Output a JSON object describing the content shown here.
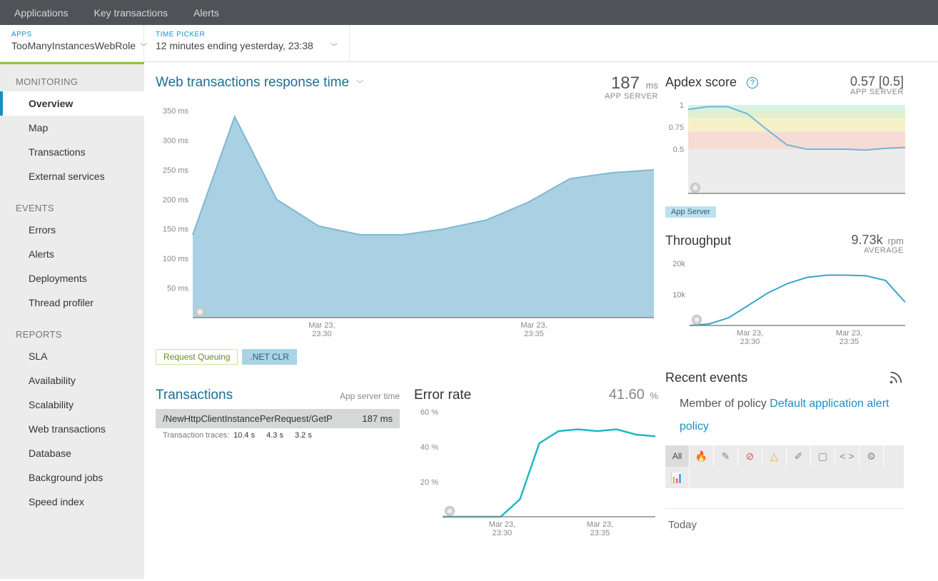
{
  "topnav": {
    "items": [
      "Applications",
      "Key transactions",
      "Alerts"
    ]
  },
  "subbar": {
    "apps_label": "APPS",
    "apps_value": "TooManyInstancesWebRole",
    "time_label": "TIME PICKER",
    "time_value": "12 minutes ending yesterday, 23:38"
  },
  "sidebar": {
    "groups": [
      {
        "label": "MONITORING",
        "items": [
          "Overview",
          "Map",
          "Transactions",
          "External services"
        ]
      },
      {
        "label": "EVENTS",
        "items": [
          "Errors",
          "Alerts",
          "Deployments",
          "Thread profiler"
        ]
      },
      {
        "label": "REPORTS",
        "items": [
          "SLA",
          "Availability",
          "Scalability",
          "Web transactions",
          "Database",
          "Background jobs",
          "Speed index"
        ]
      }
    ],
    "active": "Overview"
  },
  "response_time": {
    "title": "Web transactions response time",
    "value": "187",
    "unit": "ms",
    "sub": "APP SERVER",
    "legend": [
      {
        "label": "Request Queuing",
        "active": false
      },
      {
        "label": ".NET CLR",
        "active": true
      }
    ]
  },
  "apdex": {
    "title": "Apdex score",
    "value": "0.57 [0.5]",
    "sub": "APP SERVER",
    "legend": "App Server"
  },
  "throughput": {
    "title": "Throughput",
    "value": "9.73k",
    "unit": "rpm",
    "sub": "AVERAGE"
  },
  "transactions": {
    "title": "Transactions",
    "sub": "App server time",
    "item": {
      "name": "/NewHttpClientInstancePerRequest/GetP",
      "value": "187 ms"
    },
    "traces_label": "Transaction traces:",
    "traces": [
      "10.4 s",
      "4.3 s",
      "3.2 s"
    ]
  },
  "error_rate": {
    "title": "Error rate",
    "value": "41.60",
    "unit": "%"
  },
  "events": {
    "title": "Recent events",
    "policy_prefix": "Member of policy ",
    "policy_link": "Default application alert policy",
    "filters": [
      "All",
      "🔥",
      "✎",
      "⊘",
      "△",
      "✐",
      "▢",
      "< >",
      "⚙",
      "📊"
    ],
    "today": "Today"
  },
  "chart_data": [
    {
      "id": "response",
      "type": "area",
      "title": "Web transactions response time",
      "ylabel": "ms",
      "ylim": [
        0,
        350
      ],
      "yticks": [
        50,
        100,
        150,
        200,
        250,
        300,
        350
      ],
      "x_labels": [
        "Mar 23,\n23:30",
        "Mar 23,\n23:35"
      ],
      "x": [
        0,
        1,
        2,
        3,
        4,
        5,
        6,
        7,
        8,
        9,
        10,
        11
      ],
      "series": [
        {
          "name": ".NET CLR",
          "values": [
            140,
            340,
            200,
            155,
            140,
            140,
            150,
            165,
            195,
            235,
            245,
            250
          ]
        }
      ]
    },
    {
      "id": "apdex",
      "type": "line",
      "title": "Apdex score",
      "ylim": [
        0,
        1
      ],
      "yticks": [
        0.5,
        0.75,
        1
      ],
      "bands": [
        {
          "from": 0.94,
          "to": 1,
          "color": "#d7f2e6"
        },
        {
          "from": 0.85,
          "to": 0.94,
          "color": "#e0f0cf"
        },
        {
          "from": 0.7,
          "to": 0.85,
          "color": "#f6f0c8"
        },
        {
          "from": 0.5,
          "to": 0.7,
          "color": "#f7dcd6"
        },
        {
          "from": 0,
          "to": 0.5,
          "color": "#ececec"
        }
      ],
      "x": [
        0,
        1,
        2,
        3,
        4,
        5,
        6,
        7,
        8,
        9,
        10,
        11
      ],
      "series": [
        {
          "name": "App Server",
          "values": [
            0.95,
            0.98,
            0.98,
            0.9,
            0.72,
            0.55,
            0.5,
            0.5,
            0.5,
            0.49,
            0.51,
            0.52
          ]
        }
      ]
    },
    {
      "id": "throughput",
      "type": "line",
      "title": "Throughput",
      "ylabel": "rpm",
      "ylim": [
        0,
        20000
      ],
      "yticks": [
        10000,
        20000
      ],
      "ytick_labels": [
        "10k",
        "20k"
      ],
      "x_labels": [
        "Mar 23,\n23:30",
        "Mar 23,\n23:35"
      ],
      "x": [
        0,
        1,
        2,
        3,
        4,
        5,
        6,
        7,
        8,
        9,
        10,
        11
      ],
      "series": [
        {
          "name": "Throughput",
          "values": [
            0,
            500,
            2500,
            6500,
            10500,
            13500,
            15500,
            16200,
            16200,
            16000,
            14500,
            7500
          ]
        }
      ]
    },
    {
      "id": "error",
      "type": "line",
      "title": "Error rate",
      "ylabel": "%",
      "ylim": [
        0,
        60
      ],
      "yticks": [
        20,
        40,
        60
      ],
      "x_labels": [
        "Mar 23,\n23:30",
        "Mar 23,\n23:35"
      ],
      "x": [
        0,
        1,
        2,
        3,
        4,
        5,
        6,
        7,
        8,
        9,
        10,
        11
      ],
      "series": [
        {
          "name": "Error rate",
          "values": [
            0,
            0,
            0,
            0,
            10,
            42,
            49,
            50,
            49,
            50,
            47,
            46
          ]
        }
      ]
    }
  ]
}
